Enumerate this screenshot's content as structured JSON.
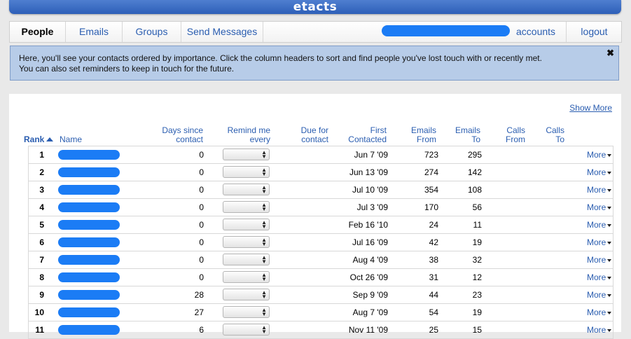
{
  "app": {
    "title": "etacts"
  },
  "nav": {
    "tabs": [
      {
        "label": "People"
      },
      {
        "label": "Emails"
      },
      {
        "label": "Groups"
      },
      {
        "label": "Send Messages"
      }
    ],
    "accounts_label": "accounts",
    "logout_label": "logout"
  },
  "info": {
    "line1": "Here, you'll see your contacts ordered by importance. Click the column headers to sort and find people you've lost touch with or recently met.",
    "line2": "You can also set reminders to keep in touch for the future.",
    "close_glyph": "✖"
  },
  "table": {
    "show_more": "Show More",
    "headers": {
      "rank": "Rank",
      "name": "Name",
      "days_since_1": "Days since",
      "days_since_2": "contact",
      "remind_1": "Remind me",
      "remind_2": "every",
      "due_1": "Due for",
      "due_2": "contact",
      "first_1": "First",
      "first_2": "Contacted",
      "efrom_1": "Emails",
      "efrom_2": "From",
      "eto_1": "Emails",
      "eto_2": "To",
      "cfrom_1": "Calls",
      "cfrom_2": "From",
      "cto_1": "Calls",
      "cto_2": "To"
    },
    "more_label": "More",
    "rows": [
      {
        "rank": "1",
        "days": "0",
        "first": "Jun 7 '09",
        "efrom": "723",
        "eto": "295"
      },
      {
        "rank": "2",
        "days": "0",
        "first": "Jun 13 '09",
        "efrom": "274",
        "eto": "142"
      },
      {
        "rank": "3",
        "days": "0",
        "first": "Jul 10 '09",
        "efrom": "354",
        "eto": "108"
      },
      {
        "rank": "4",
        "days": "0",
        "first": "Jul 3 '09",
        "efrom": "170",
        "eto": "56"
      },
      {
        "rank": "5",
        "days": "0",
        "first": "Feb 16 '10",
        "efrom": "24",
        "eto": "11"
      },
      {
        "rank": "6",
        "days": "0",
        "first": "Jul 16 '09",
        "efrom": "42",
        "eto": "19"
      },
      {
        "rank": "7",
        "days": "0",
        "first": "Aug 4 '09",
        "efrom": "38",
        "eto": "32"
      },
      {
        "rank": "8",
        "days": "0",
        "first": "Oct 26 '09",
        "efrom": "31",
        "eto": "12"
      },
      {
        "rank": "9",
        "days": "28",
        "first": "Sep 9 '09",
        "efrom": "44",
        "eto": "23"
      },
      {
        "rank": "10",
        "days": "27",
        "first": "Aug 7 '09",
        "efrom": "54",
        "eto": "19"
      },
      {
        "rank": "11",
        "days": "6",
        "first": "Nov 11 '09",
        "efrom": "25",
        "eto": "15"
      }
    ]
  }
}
